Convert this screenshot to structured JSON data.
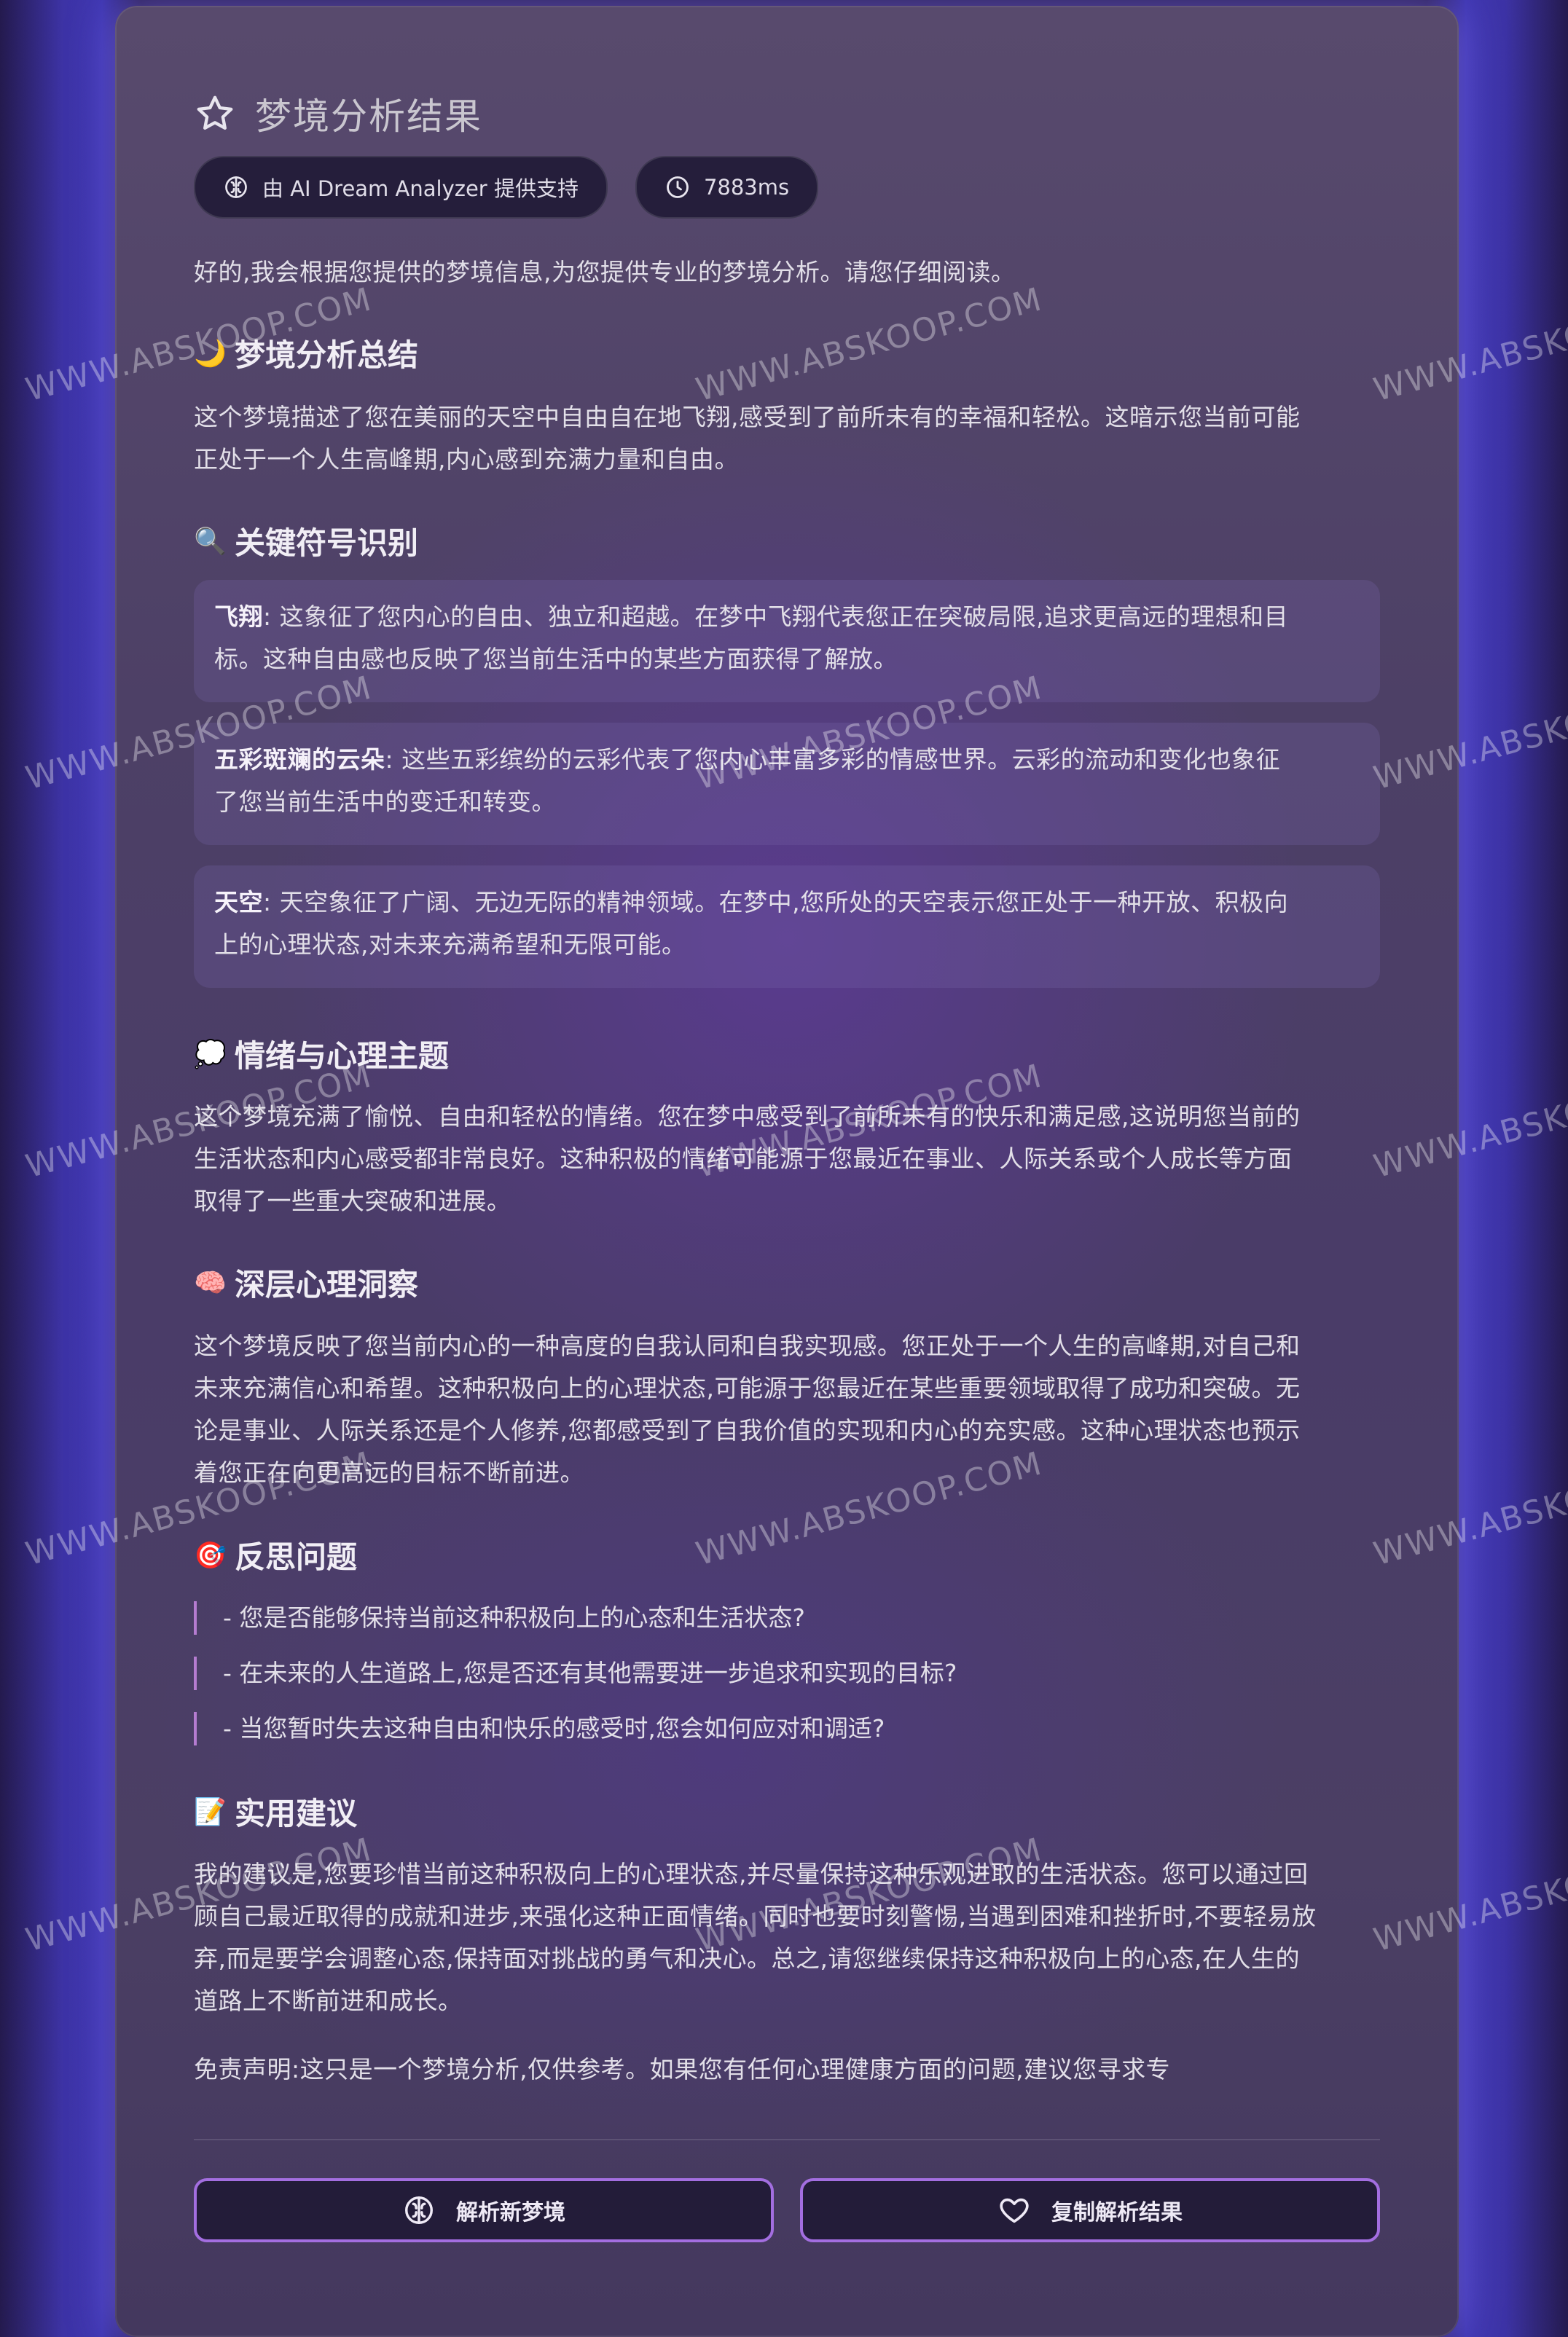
{
  "title": "梦境分析结果",
  "badges": {
    "provider": "由 AI Dream Analyzer 提供支持",
    "duration": "7883ms"
  },
  "intro": "好的,我会根据您提供的梦境信息,为您提供专业的梦境分析。请您仔细阅读。",
  "sections": {
    "summary": {
      "emoji": "🌙",
      "heading": "梦境分析总结",
      "lines": [
        "这个梦境描述了您在美丽的天空中自由自在地飞翔,感受到了前所未有的幸福和轻松。这暗示您当前可能",
        "正处于一个人生高峰期,内心感到充满力量和自由。"
      ]
    },
    "symbols": {
      "emoji": "🔍",
      "heading": "关键符号识别",
      "items": [
        {
          "term": "飞翔",
          "lines": [
            ": 这象征了您内心的自由、独立和超越。在梦中飞翔代表您正在突破局限,追求更高远的理想和目",
            "标。这种自由感也反映了您当前生活中的某些方面获得了解放。"
          ]
        },
        {
          "term": "五彩斑斓的云朵",
          "lines": [
            ": 这些五彩缤纷的云彩代表了您内心丰富多彩的情感世界。云彩的流动和变化也象征",
            "了您当前生活中的变迁和转变。"
          ]
        },
        {
          "term": "天空",
          "lines": [
            ": 天空象征了广阔、无边无际的精神领域。在梦中,您所处的天空表示您正处于一种开放、积极向",
            "上的心理状态,对未来充满希望和无限可能。"
          ]
        }
      ]
    },
    "emotion": {
      "emoji": "💭",
      "heading": "情绪与心理主题",
      "lines": [
        "这个梦境充满了愉悦、自由和轻松的情绪。您在梦中感受到了前所未有的快乐和满足感,这说明您当前的",
        "生活状态和内心感受都非常良好。这种积极的情绪可能源于您最近在事业、人际关系或个人成长等方面",
        "取得了一些重大突破和进展。"
      ]
    },
    "insight": {
      "emoji": "🧠",
      "heading": "深层心理洞察",
      "lines": [
        "这个梦境反映了您当前内心的一种高度的自我认同和自我实现感。您正处于一个人生的高峰期,对自己和",
        "未来充满信心和希望。这种积极向上的心理状态,可能源于您最近在某些重要领域取得了成功和突破。无",
        "论是事业、人际关系还是个人修养,您都感受到了自我价值的实现和内心的充实感。这种心理状态也预示",
        "着您正在向更高远的目标不断前进。"
      ]
    },
    "reflection": {
      "emoji": "🎯",
      "heading": "反思问题",
      "questions": [
        "- 您是否能够保持当前这种积极向上的心态和生活状态?",
        "- 在未来的人生道路上,您是否还有其他需要进一步追求和实现的目标?",
        "- 当您暂时失去这种自由和快乐的感受时,您会如何应对和调适?"
      ]
    },
    "advice": {
      "emoji": "📝",
      "heading": "实用建议",
      "lines": [
        "我的建议是,您要珍惜当前这种积极向上的心理状态,并尽量保持这种乐观进取的生活状态。您可以通过回",
        "顾自己最近取得的成就和进步,来强化这种正面情绪。同时也要时刻警惕,当遇到困难和挫折时,不要轻易放",
        "弃,而是要学会调整心态,保持面对挑战的勇气和决心。总之,请您继续保持这种积极向上的心态,在人生的",
        "道路上不断前进和成长。"
      ]
    }
  },
  "disclaimer": "免责声明:这只是一个梦境分析,仅供参考。如果您有任何心理健康方面的问题,建议您寻求专",
  "buttons": {
    "new_dream": "解析新梦境",
    "copy_result": "复制解析结果"
  },
  "watermark": "WWW.ABSKOOP.COM",
  "colors": {
    "accent": "#a36ee0",
    "quote_bar": "#b57cd0",
    "background_blue": "#3e36b0"
  }
}
